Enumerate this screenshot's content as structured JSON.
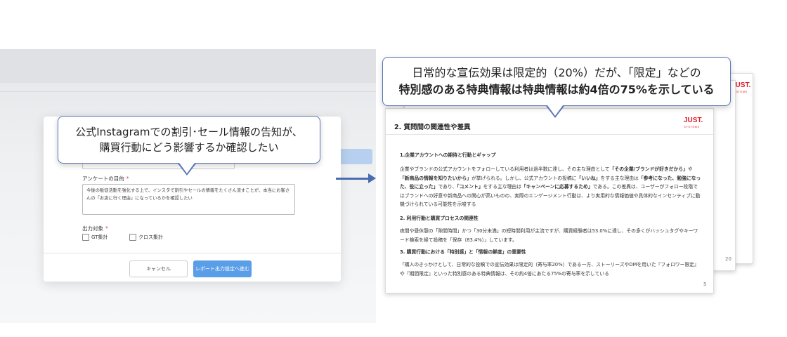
{
  "left": {
    "purpose_label": "アンケートの目的",
    "purpose_required": "*",
    "purpose_text": "今後の販促活動を強化する上で、インスタで割引やセールの情報をたくさん流すことが、本当にお客さんの「お店に行く理由」になっているかを確認したい",
    "output_label": "出力対象",
    "output_required": "*",
    "checkbox_gt": "GT集計",
    "checkbox_cross": "クロス集計",
    "cancel_button": "キャンセル",
    "next_button": "レポート出力設定へ進む"
  },
  "bubble_left": {
    "line1": "公式Instagramでの割引･セール情報の告知が、",
    "line2": "購買行動にどう影響するか確認したい"
  },
  "bubble_right": {
    "line1": "日常的な宣伝効果は限定的（20%）だが、「限定」などの",
    "line2": "特別感のある特典情報は特典情報は約4倍の75%を示している"
  },
  "slides": {
    "logo_text": "JUST.",
    "logo_sub": "SYSTEMS",
    "back_page_number": "20",
    "front_page_number": "5",
    "title": "2. 質問間の関連性や差異",
    "sec1_heading": "1.企業アカウントへの期待と行動とギャップ",
    "sec1_p1": "企業やブランドの公式アカウントをフォローしている利用者は過半数に達し、その主な理由として",
    "sec1_b1": "「その企業/ブランドが好きだから」",
    "sec1_p2": "や",
    "sec1_b2": "「新商品の情報を知りたいから」",
    "sec1_p3": "が挙げられる。しかし、公式アカウントの投稿に",
    "sec1_b3": "「いいね」",
    "sec1_p4": "をする主な理由は",
    "sec1_b4": "「参考になった、勉強になった、役に立った」",
    "sec1_p5": "であり、",
    "sec1_b5": "「コメント」",
    "sec1_p6": "をする主な理由は",
    "sec1_b6": "「キャンペーンに応募するため」",
    "sec1_p7": "である。この差異は、ユーザーがフォロー段階ではブランドへの好意や新商品への関心が高いものの、実際のエンゲージメント行動は、より実用的な情報価値や具体的なインセンティブに動機づけられている可能性を示唆する",
    "sec2_heading": "2. 利用行動と購買プロセスの関連性",
    "sec2_text": "夜間や昼休憩の「隙間時間」かつ「30分未満」の短時間利用が主流ですが、購買経験者は53.0%に達し、その多くがハッシュタグやキーワード検索を経て投稿を「保存（83.4%）」しています。",
    "sec3_heading_a": "3. 購買行動における「",
    "sec3_heading_b": "特別感",
    "sec3_heading_c": "」と「",
    "sec3_heading_d": "情報の鮮度",
    "sec3_heading_e": "」の重要性",
    "sec3_text": "「購入のきっかけとして、日常的な投稿での宣伝効果は限定的（寄与率20%）である一方、ストーリーズやDMを用いた『フォロワー限定』や『期間限定』といった特別感のある特典情報は、その約4倍にあたる75%の寄与率を示している"
  },
  "colors": {
    "accent_blue": "#5b9ee8",
    "bubble_border": "#5a77b5",
    "logo_red": "#e21b2a",
    "required_red": "#e04848"
  }
}
